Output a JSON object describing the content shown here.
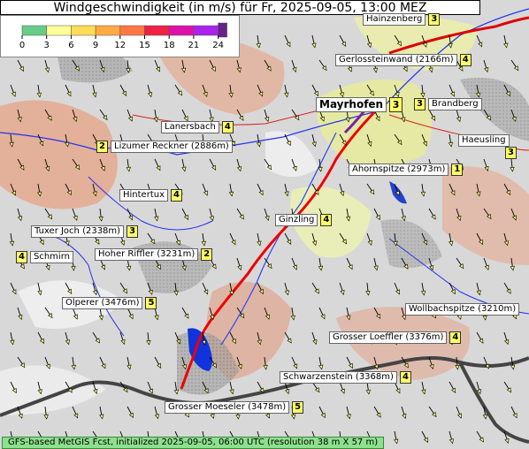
{
  "title": "Windgeschwindigkeit (in m/s) für Fr, 2025-09-05, 13:00 MEZ",
  "legend": {
    "ticks": [
      "0",
      "3",
      "6",
      "9",
      "12",
      "15",
      "18",
      "21",
      "24"
    ],
    "colors": [
      "#66cc88",
      "#ffff99",
      "#ffdd55",
      "#ffaa44",
      "#ff7744",
      "#ee2244",
      "#dd11aa",
      "#aa22ee",
      "#662288"
    ]
  },
  "places": [
    {
      "name": "Hainzenberg",
      "value": "3"
    },
    {
      "name": "Gerlossteinwand (2166m)",
      "value": "4"
    },
    {
      "name": "Mayrhofen",
      "value": "3"
    },
    {
      "name": "Brandberg",
      "value": "3"
    },
    {
      "name": "Lanersbach",
      "value": "4"
    },
    {
      "name": "Lizumer Reckner (2886m)",
      "value": "2"
    },
    {
      "name": "Haeusling",
      "value": "3"
    },
    {
      "name": "Ahornspitze (2973m)",
      "value": "1"
    },
    {
      "name": "Hintertux",
      "value": "4"
    },
    {
      "name": "Ginzling",
      "value": "4"
    },
    {
      "name": "Tuxer Joch (2338m)",
      "value": "3"
    },
    {
      "name": "Schmirn",
      "value": "4"
    },
    {
      "name": "Hoher Riffler (3231m)",
      "value": "2"
    },
    {
      "name": "Olperer (3476m)",
      "value": "5"
    },
    {
      "name": "Wollbachspitze (3210m)",
      "value": ""
    },
    {
      "name": "Grosser Loeffler (3376m)",
      "value": "4"
    },
    {
      "name": "Schwarzenstein (3368m)",
      "value": "4"
    },
    {
      "name": "Grosser Moeseler (3478m)",
      "value": "5"
    }
  ],
  "footer": "GFS-based MetGIS Fcst, initialized 2025-09-05, 06:00 UTC  (resolution 38 m X 57 m)"
}
